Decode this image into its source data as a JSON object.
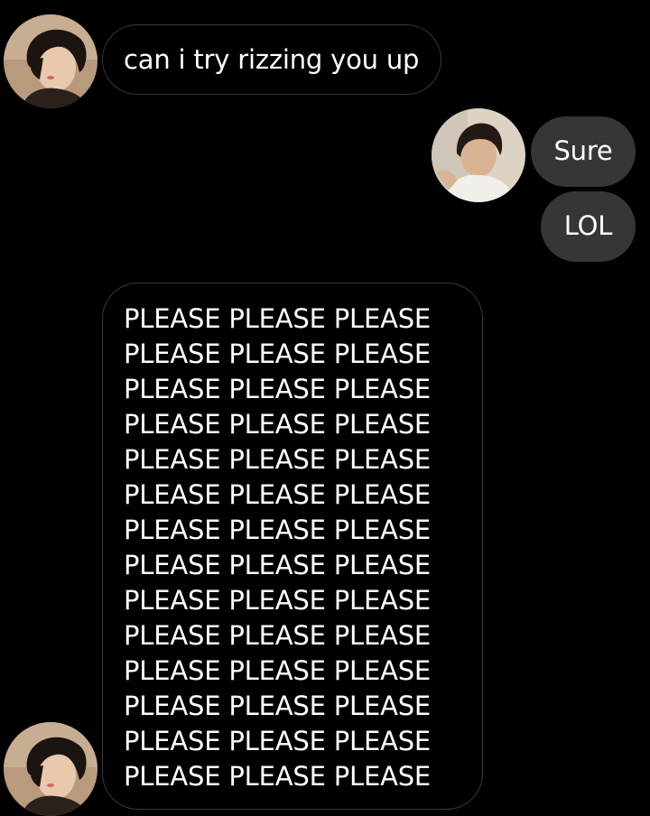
{
  "conversation": {
    "messages": [
      {
        "sender": "them",
        "text": "can i try rizzing you up"
      },
      {
        "sender": "me",
        "text": "Sure"
      },
      {
        "sender": "me",
        "text": "LOL"
      },
      {
        "sender": "them",
        "lines": [
          "PLEASE PLEASE PLEASE",
          "PLEASE PLEASE PLEASE",
          "PLEASE PLEASE PLEASE",
          "PLEASE PLEASE PLEASE",
          "PLEASE PLEASE PLEASE",
          "PLEASE PLEASE PLEASE",
          "PLEASE PLEASE PLEASE",
          "PLEASE PLEASE PLEASE",
          "PLEASE PLEASE PLEASE",
          "PLEASE PLEASE PLEASE",
          "PLEASE PLEASE PLEASE",
          "PLEASE PLEASE PLEASE",
          "PLEASE PLEASE PLEASE",
          "PLEASE PLEASE PLEASE"
        ]
      }
    ]
  },
  "theme": {
    "background": "#000000",
    "incoming_bubble_border": "#3a3a3a",
    "outgoing_bubble_fill": "#363636",
    "text": "#ffffff"
  },
  "icons": {
    "contact_avatar": "contact-avatar-icon",
    "user_avatar": "user-avatar-icon"
  }
}
